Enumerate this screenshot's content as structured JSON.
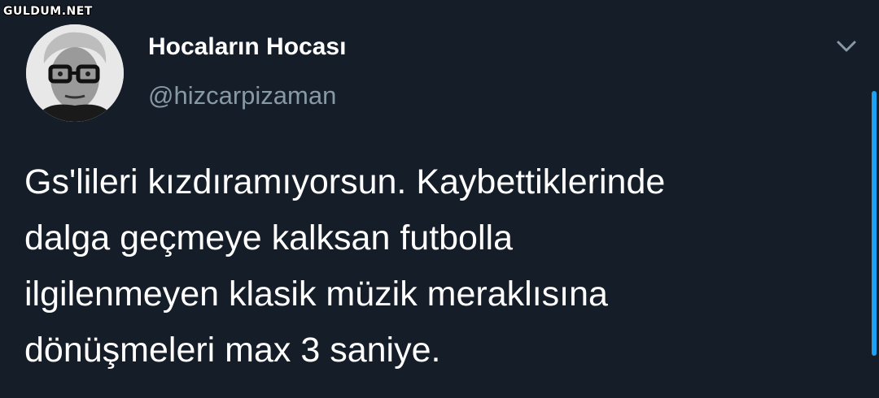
{
  "watermark": "GULDUM.NET",
  "tweet": {
    "display_name": "Hocaların Hocası",
    "handle": "@hizcarpizaman",
    "text_lines": [
      "Gs'lileri kızdıramıyorsun. Kaybettiklerinde",
      "dalga geçmeye kalksan futbolla",
      "ilgilenmeyen klasik müzik meraklısına",
      "dönüşmeleri max 3 saniye."
    ]
  },
  "icons": {
    "menu": "chevron-down-icon"
  },
  "colors": {
    "background": "#151d28",
    "text": "#ffffff",
    "secondary": "#8899a6",
    "accent": "#1da1f2"
  }
}
